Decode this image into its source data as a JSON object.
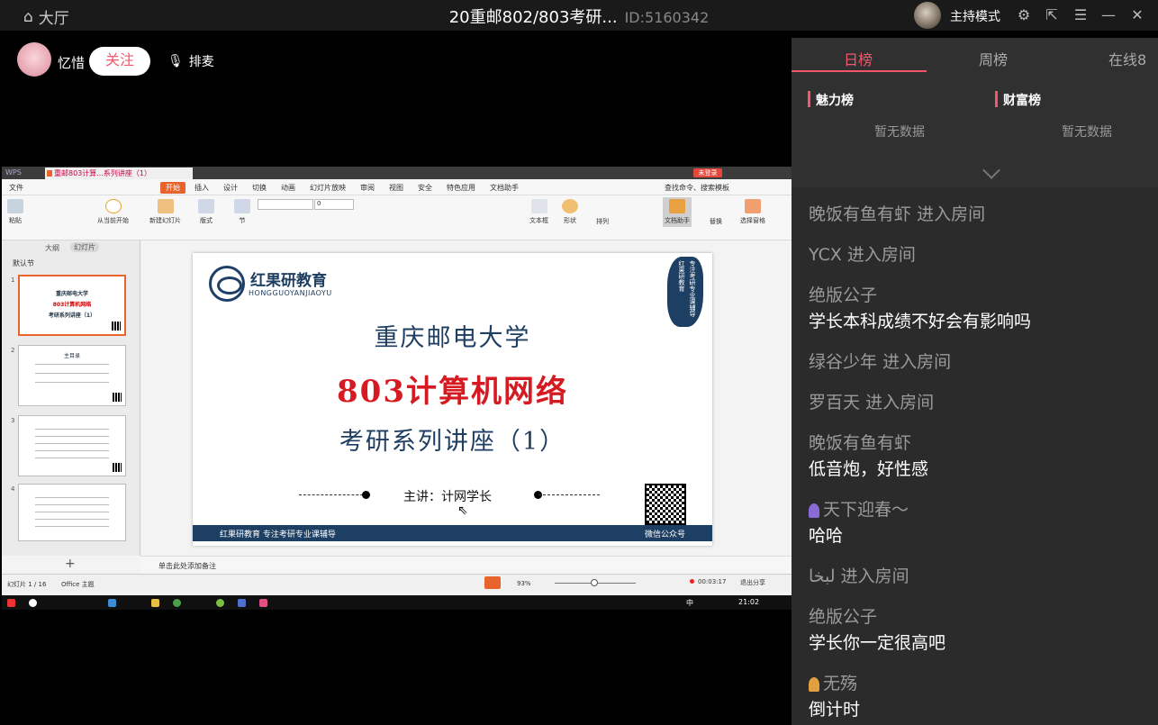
{
  "topbar": {
    "home_label": "大厅",
    "title": "20重邮802/803考研...",
    "room_id": "ID:5160342",
    "host_mode": "主持模式"
  },
  "streamer": {
    "name": "忆惜",
    "follow_label": "关注",
    "mic_label": "排麦"
  },
  "wps": {
    "app_label": "WPS",
    "tab_label": "重邮803计算...系列讲座（1）",
    "red_button": "未登录",
    "menu": [
      "文件",
      "开始",
      "插入",
      "设计",
      "切换",
      "动画",
      "幻灯片放映",
      "审阅",
      "视图",
      "安全",
      "特色应用",
      "文档助手"
    ],
    "search_label": "查找命令、搜索模板",
    "ribbon": [
      "粘贴",
      "从当前开始",
      "新建幻灯片",
      "版式",
      "节",
      "文本框",
      "形状",
      "排列",
      "文档助手",
      "替换",
      "选择窗格"
    ],
    "font_size": "0",
    "left_tabs": [
      "大纲",
      "幻灯片"
    ],
    "default_section": "默认节",
    "thumbs": [
      {
        "num": "1",
        "line1": "重庆邮电大学",
        "line2": "803计算机网络",
        "line3": "考研系列讲座（1）"
      },
      {
        "num": "2",
        "line1": "主目录",
        "line2": "",
        "line3": ""
      },
      {
        "num": "3",
        "line1": "",
        "line2": "",
        "line3": ""
      },
      {
        "num": "4",
        "line1": "",
        "line2": "",
        "line3": ""
      }
    ],
    "notes_placeholder": "单击此处添加备注",
    "status_slide": "幻灯片 1 / 16",
    "status_theme": "Office 主题",
    "zoom": "93%",
    "rec_time": "00:03:17",
    "exit_share": "退出分享",
    "clock": "21:02",
    "ime": "中"
  },
  "slide": {
    "logo_cn": "红果研教育",
    "logo_en": "HONGGUOYANJIAOYU",
    "seal_text": "专注考研专业课辅导 红果研教育",
    "university": "重庆邮电大学",
    "course": "803计算机网络",
    "series": "考研系列讲座（1）",
    "speaker": "主讲：计网学长",
    "footer_left": "红果研教育    专注考研专业课辅导",
    "footer_right": "微信公众号"
  },
  "rank": {
    "tabs": [
      "日榜",
      "周榜",
      "在线8"
    ],
    "charm": "魅力榜",
    "wealth": "财富榜",
    "no_data": "暂无数据"
  },
  "chat": [
    {
      "user": "晚饭有鱼有虾",
      "text": "进入房间",
      "type": "enter"
    },
    {
      "user": "YCX",
      "text": "进入房间",
      "type": "enter"
    },
    {
      "user": "绝版公子",
      "text": "学长本科成绩不好会有影响吗",
      "type": "msg"
    },
    {
      "user": "绿谷少年",
      "text": "进入房间",
      "type": "enter"
    },
    {
      "user": "罗百天",
      "text": "进入房间",
      "type": "enter"
    },
    {
      "user": "晚饭有鱼有虾",
      "text": "低音炮，好性感",
      "type": "msg"
    },
    {
      "user": "天下迎春～",
      "text": "哈哈",
      "type": "msg"
    },
    {
      "user": "لبخا",
      "text": "进入房间",
      "type": "enter"
    },
    {
      "user": "绝版公子",
      "text": "学长你一定很高吧",
      "type": "msg"
    },
    {
      "user": "无殇",
      "text": "倒计时",
      "type": "msg"
    }
  ],
  "colors": {
    "accent": "#f5566a",
    "slide_blue": "#1e3e62",
    "slide_red": "#d51a22",
    "wps_orange": "#e8642c"
  }
}
